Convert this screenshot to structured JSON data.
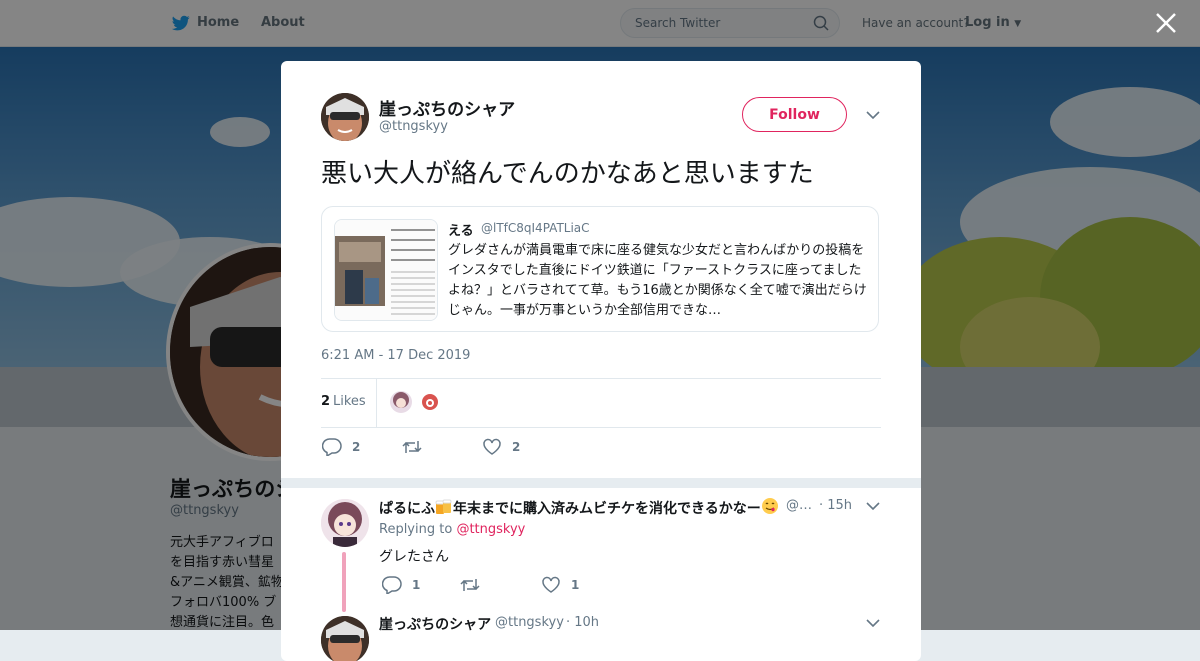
{
  "topbar": {
    "home_label": "Home",
    "about_label": "About",
    "search_placeholder": "Search Twitter",
    "have_account": "Have an account?",
    "login_label": "Log in"
  },
  "profile": {
    "name": "崖っぷちのシャア",
    "handle": "@ttngskyy",
    "bio": "元大手アフィブロ\nを目指す赤い彗星\n&アニメ観賞、鉱物\nフォロバ100% ブ\n想通貨に注目。色"
  },
  "tweet": {
    "author_name": "崖っぷちのシャア",
    "author_handle": "@ttngskyy",
    "follow_label": "Follow",
    "text": "悪い大人が絡んでんのかなあと思いますた",
    "timestamp": "6:21 AM - 17 Dec 2019",
    "likes_count": "2",
    "likes_label": "Likes",
    "reply_count": "2",
    "like_count": "2"
  },
  "quote": {
    "name": "える",
    "handle": "@lTfC8qI4PATLiaC",
    "text": "グレダさんが満員電車で床に座る健気な少女だと言わんばかりの投稿をインスタでした直後にドイツ鉄道に「ファーストクラスに座ってましたよね？」とバラされてて草。もう16歳とか関係なく全て嘘で演出だらけじゃん。一事が万事というか全部信用できな…"
  },
  "replies": [
    {
      "name_before": "ぱるにふ",
      "name_after": "年末までに購入済みムビチケを消化できるかなー",
      "handle": "@…",
      "time": "· 15h",
      "replying_prefix": "Replying to",
      "replying_to": "@ttngskyy",
      "text": "グレたさん",
      "reply_count": "1",
      "like_count": "1"
    },
    {
      "name": "崖っぷちのシャア",
      "handle": "@ttngskyy",
      "time": "· 10h"
    }
  ],
  "colors": {
    "accent": "#e0245e",
    "twitter_blue": "#1da1f2",
    "muted": "#657786"
  }
}
